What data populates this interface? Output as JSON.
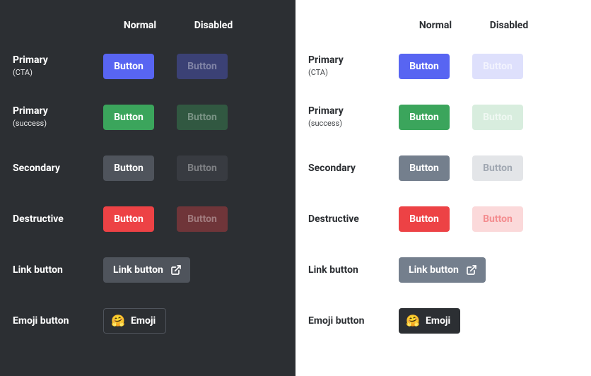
{
  "columns": {
    "normal": "Normal",
    "disabled": "Disabled"
  },
  "rows": {
    "primary": {
      "label": "Primary",
      "sub": "(CTA)",
      "btn_text": "Button"
    },
    "success": {
      "label": "Primary",
      "sub": "(success)",
      "btn_text": "Button"
    },
    "secondary": {
      "label": "Secondary",
      "btn_text": "Button"
    },
    "destruct": {
      "label": "Destructive",
      "btn_text": "Button"
    },
    "link": {
      "label": "Link button",
      "btn_text": "Link button"
    },
    "emoji": {
      "label": "Emoji button",
      "btn_text": "Emoji",
      "emoji": "🤗"
    }
  },
  "colors": {
    "primary": "#5865f2",
    "success": "#3ba55c",
    "secondary": "#4f545c",
    "destruct": "#ed4245",
    "bg_dark": "#2c2f33",
    "bg_light": "#ffffff"
  }
}
